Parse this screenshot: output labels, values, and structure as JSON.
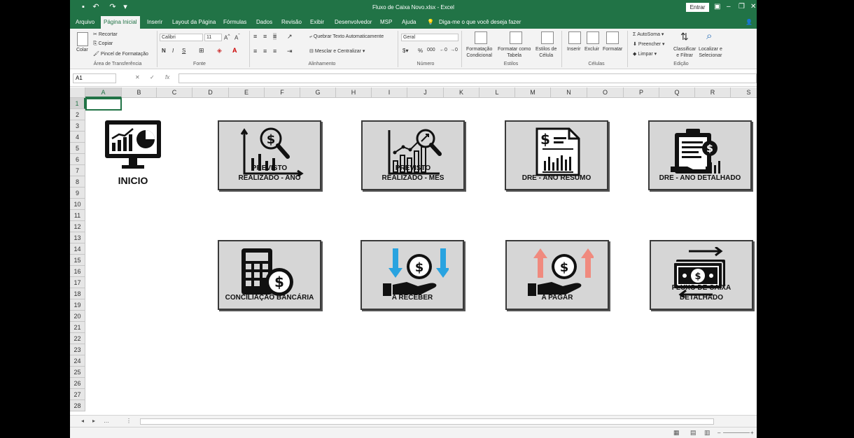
{
  "window": {
    "title": "Fluxo de Caixa Novo.xlsx  -  Excel",
    "signin_label": "Entrar",
    "minimize": "–",
    "restore": "❐",
    "close": "✕"
  },
  "tabs": [
    {
      "label": "Arquivo"
    },
    {
      "label": "Página Inicial"
    },
    {
      "label": "Inserir"
    },
    {
      "label": "Layout da Página"
    },
    {
      "label": "Fórmulas"
    },
    {
      "label": "Dados"
    },
    {
      "label": "Revisão"
    },
    {
      "label": "Exibir"
    },
    {
      "label": "Desenvolvedor"
    },
    {
      "label": "MSP"
    },
    {
      "label": "Ajuda"
    }
  ],
  "tell_me": "Diga-me o que você deseja fazer",
  "ribbon": {
    "clipboard": {
      "paste": "Colar",
      "cut": "Recortar",
      "copy": "Copiar",
      "format_painter": "Pincel de Formatação",
      "group": "Área de Transferência"
    },
    "font": {
      "name": "Calibri",
      "size": "11",
      "bold": "N",
      "italic": "I",
      "underline": "S",
      "group": "Fonte"
    },
    "alignment": {
      "wrap": "Quebrar Texto Automaticamente",
      "merge": "Mesclar e Centralizar",
      "group": "Alinhamento"
    },
    "number": {
      "format": "Geral",
      "percent": "%",
      "comma": "000",
      "group": "Número"
    },
    "styles": {
      "conditional": "Formatação\nCondicional",
      "table": "Formatar como\nTabela",
      "cell": "Estilos de\nCélula",
      "group": "Estilos"
    },
    "cells": {
      "insert": "Inserir",
      "delete": "Excluir",
      "format": "Formatar",
      "group": "Células"
    },
    "editing": {
      "autosum": "AutoSoma",
      "fill": "Preencher",
      "clear": "Limpar",
      "sort": "Classificar\ne Filtrar",
      "find": "Localizar e\nSelecionar",
      "group": "Edição"
    }
  },
  "formula_bar": {
    "name_box": "A1",
    "fx": "fx",
    "value": ""
  },
  "columns": [
    "A",
    "B",
    "C",
    "D",
    "E",
    "F",
    "G",
    "H",
    "I",
    "J",
    "K",
    "L",
    "M",
    "N",
    "O",
    "P",
    "Q",
    "R",
    "S"
  ],
  "rows": [
    "1",
    "2",
    "3",
    "4",
    "5",
    "6",
    "7",
    "8",
    "9",
    "10",
    "11",
    "12",
    "13",
    "14",
    "15",
    "16",
    "17",
    "18",
    "19",
    "20",
    "21",
    "22",
    "23",
    "24",
    "25",
    "26",
    "27",
    "28"
  ],
  "inicio": {
    "label": "INICIO"
  },
  "cards": [
    {
      "label": "PREVISTO\nREALIZADO - ANO",
      "icon": "chart-search-icon"
    },
    {
      "label": "PREVISTO\nREALIZADO - MÊS",
      "icon": "bar-chart-magnifier-icon"
    },
    {
      "label": "DRE - ANO RESUMO",
      "icon": "document-chart-icon"
    },
    {
      "label": "DRE - ANO DETALHADO",
      "icon": "clipboard-money-icon"
    },
    {
      "label": "CONCILIAÇÃO BANCÁRIA",
      "icon": "calculator-coin-icon"
    },
    {
      "label": "A RECEBER",
      "icon": "receive-money-icon"
    },
    {
      "label": "A PAGAR",
      "icon": "pay-money-icon"
    },
    {
      "label": "FLUXO DE CAIXA\nDETALHADO",
      "icon": "cash-flow-icon"
    }
  ],
  "colors": {
    "excel_green": "#217346",
    "receive_arrow": "#29a3e0",
    "pay_arrow": "#f08a7e"
  }
}
